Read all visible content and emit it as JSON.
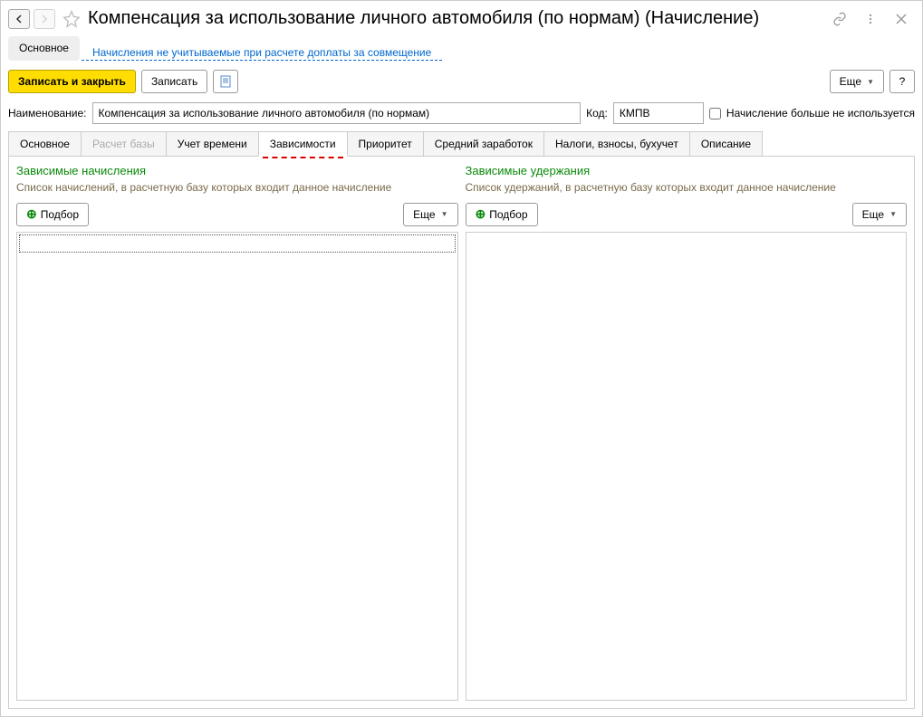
{
  "header": {
    "title": "Компенсация за использование личного автомобиля (по нормам) (Начисление)"
  },
  "subnav": {
    "main": "Основное",
    "link": "Начисления не учитываемые при расчете доплаты за совмещение"
  },
  "toolbar": {
    "save_close": "Записать и закрыть",
    "save": "Записать",
    "more": "Еще",
    "help": "?"
  },
  "form": {
    "name_label": "Наименование:",
    "name_value": "Компенсация за использование личного автомобиля (по нормам)",
    "code_label": "Код:",
    "code_value": "КМПВ",
    "not_used": "Начисление больше не используется"
  },
  "tabs": {
    "t0": "Основное",
    "t1": "Расчет базы",
    "t2": "Учет времени",
    "t3": "Зависимости",
    "t4": "Приоритет",
    "t5": "Средний заработок",
    "t6": "Налоги, взносы, бухучет",
    "t7": "Описание"
  },
  "panels": {
    "left": {
      "title": "Зависимые начисления",
      "desc": "Список начислений, в расчетную базу которых входит данное начисление",
      "pick": "Подбор",
      "more": "Еще"
    },
    "right": {
      "title": "Зависимые удержания",
      "desc": "Список удержаний, в расчетную базу которых входит данное начисление",
      "pick": "Подбор",
      "more": "Еще"
    }
  }
}
